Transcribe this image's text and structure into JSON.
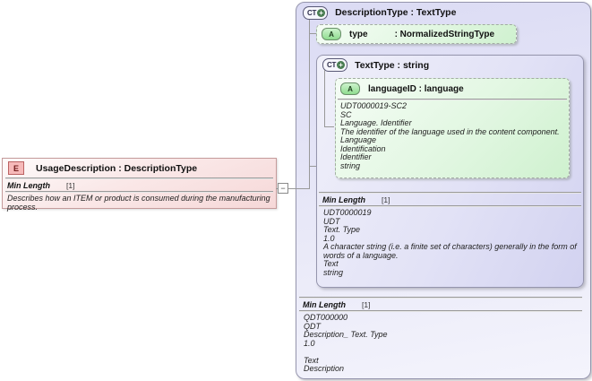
{
  "colors": {
    "element_pink": "#f6b9b9",
    "attribute_green": "#8fdc8f",
    "complex_type_lavender": "#dcdcf5",
    "line_gray": "#999999"
  },
  "icons": {
    "plus": "+",
    "collapse": "−"
  },
  "element_box": {
    "badge": "E",
    "title": "UsageDescription : DescriptionType",
    "facet": {
      "name": "Min Length",
      "cardinality": "[1]"
    },
    "description": "Describes how an ITEM or product is consumed during the manufacturing process."
  },
  "description_type_box": {
    "badge": "CT",
    "title": "DescriptionType : TextType",
    "type_attribute": {
      "badge": "A",
      "name": "type",
      "type": ": NormalizedStringType"
    },
    "text_type_box": {
      "badge": "CT",
      "title": "TextType : string",
      "language_attribute": {
        "badge": "A",
        "title": "languageID : language",
        "docs": [
          "UDT0000019-SC2",
          "SC",
          "Language. Identifier",
          "The identifier of the language used in the content component.",
          "Language",
          "Identification",
          "Identifier",
          "string"
        ]
      },
      "facet": {
        "name": "Min Length",
        "cardinality": "[1]"
      },
      "docs": [
        "UDT0000019",
        "UDT",
        "Text. Type",
        "1.0",
        "A character string (i.e. a finite set of characters) generally in the form of words of a language.",
        "Text",
        "string"
      ]
    },
    "facet": {
      "name": "Min Length",
      "cardinality": "[1]"
    },
    "docs": [
      "QDT000000",
      "QDT",
      "Description_ Text. Type",
      "1.0",
      "",
      "Text",
      "Description"
    ]
  }
}
